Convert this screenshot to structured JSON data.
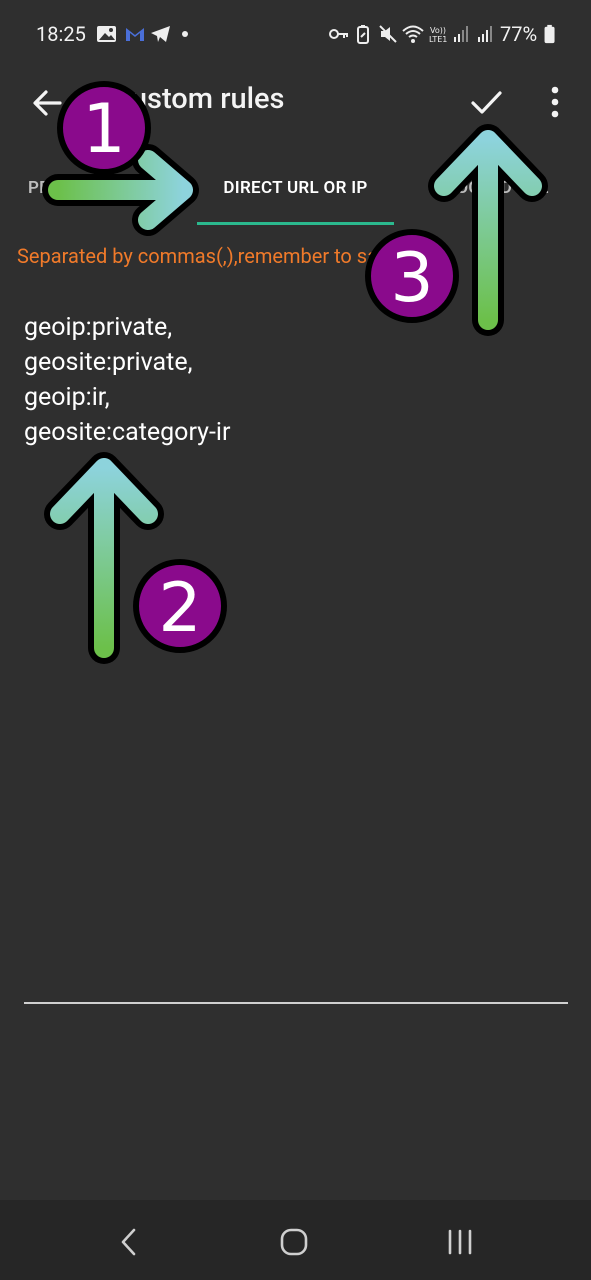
{
  "status_bar": {
    "time": "18:25",
    "battery_percent": "77%",
    "icons": [
      "gallery-icon",
      "gmail-icon",
      "telegram-icon",
      "dot-icon",
      "key-icon",
      "battery-saver-icon",
      "mute-icon",
      "wifi-icon",
      "volte-icon",
      "signal-icon",
      "signal-icon",
      "battery-icon"
    ]
  },
  "toolbar": {
    "title": "Custom rules",
    "back_icon": "arrow-back-icon",
    "confirm_icon": "check-icon",
    "more_icon": "more-vert-icon"
  },
  "tabs": [
    {
      "label": "PROXY URL OR IP",
      "selected": false
    },
    {
      "label": "DIRECT URL OR IP",
      "selected": true
    },
    {
      "label": "BLOCKED URL",
      "selected": false
    }
  ],
  "hint": "Separated by commas(,),remember to save",
  "editor": {
    "value": "geoip:private,\ngeosite:private,\ngeoip:ir,\ngeosite:category-ir"
  },
  "annotations": [
    {
      "number": "1"
    },
    {
      "number": "2"
    },
    {
      "number": "3"
    }
  ],
  "colors": {
    "background": "#2f2f2f",
    "tab_indicator": "#2bb98e",
    "hint": "#f07a2a",
    "badge": "#8a0a8c",
    "arrow_start": "#8dd3dc",
    "arrow_end": "#6cc04a"
  }
}
